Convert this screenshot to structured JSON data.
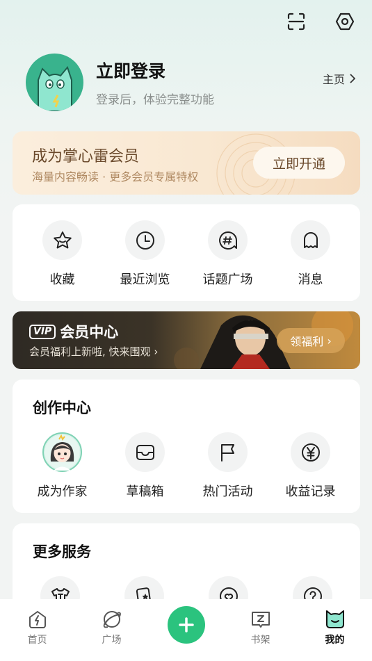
{
  "header": {
    "scan_icon": "scan-icon",
    "settings_icon": "settings-icon"
  },
  "profile": {
    "title": "立即登录",
    "subtitle": "登录后，体验完整功能",
    "home_link": "主页"
  },
  "vip": {
    "title": "成为掌心雷会员",
    "subtitle": "海量内容畅读 · 更多会员专属特权",
    "button": "立即开通"
  },
  "quick": [
    {
      "label": "收藏",
      "icon": "star-icon"
    },
    {
      "label": "最近浏览",
      "icon": "clock-icon"
    },
    {
      "label": "话题广场",
      "icon": "topic-icon"
    },
    {
      "label": "消息",
      "icon": "bell-icon"
    }
  ],
  "member_center": {
    "tag": "VIP",
    "title": "会员中心",
    "subtitle": "会员福利上新啦, 快来围观",
    "button": "领福利"
  },
  "creation": {
    "title": "创作中心",
    "items": [
      {
        "label": "成为作家",
        "icon": "writer-avatar-icon"
      },
      {
        "label": "草稿箱",
        "icon": "inbox-icon"
      },
      {
        "label": "热门活动",
        "icon": "flag-icon"
      },
      {
        "label": "收益记录",
        "icon": "yen-icon"
      }
    ]
  },
  "more": {
    "title": "更多服务"
  },
  "tabbar": {
    "items": [
      {
        "label": "首页",
        "icon": "home-bolt-icon"
      },
      {
        "label": "广场",
        "icon": "planet-icon"
      },
      {
        "label": "",
        "icon": "plus-icon"
      },
      {
        "label": "书架",
        "icon": "bookshelf-icon"
      },
      {
        "label": "我的",
        "icon": "mine-icon"
      }
    ]
  },
  "colors": {
    "accent": "#2bc37e",
    "avatar_bg": "#39b38d",
    "vip_text": "#6b4a2c"
  }
}
